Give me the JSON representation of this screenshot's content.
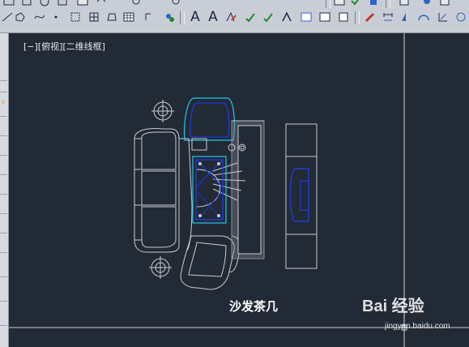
{
  "toolbar": {
    "row1_icons": [
      "move-icon",
      "rotate-icon",
      "scale-icon",
      "mirror-icon",
      "offset-icon",
      "undo-icon",
      "zoom-icon",
      "layer-icon",
      "check-icon",
      "visual-icon",
      "settings-icon",
      "lock-icon",
      "eye-icon",
      "grid-icon"
    ],
    "row2_icons": [
      "line-icon",
      "polygon-icon",
      "dot-icon",
      "hatch-icon",
      "table-icon",
      "region-icon",
      "grid-table-icon",
      "insert-icon",
      "text-icon",
      "text-style-icon",
      "edit-text-icon",
      "spell-icon",
      "find-replace-icon",
      "scale-text-icon",
      "justify-icon",
      "mtext-icon",
      "match-prop-icon",
      "explode-icon",
      "paint-icon",
      "dimension-icon",
      "arc-icon",
      "ordinate-icon",
      "radius-icon"
    ],
    "text_glyphs": [
      "A",
      "A"
    ]
  },
  "viewport": {
    "label": "[−][俯视][二维线框]",
    "background_color": "#222a36",
    "crosshair_color": "#ffffff"
  },
  "drawing": {
    "caption": "沙发茶几",
    "colors": {
      "outline": "#c8ccd2",
      "blue": "#1f3bd6",
      "cyan": "#27c7e5",
      "hatch": "#8a8f96"
    }
  },
  "watermark": {
    "logo": "Bai 经验",
    "url": "jingyan.baidu.com"
  }
}
